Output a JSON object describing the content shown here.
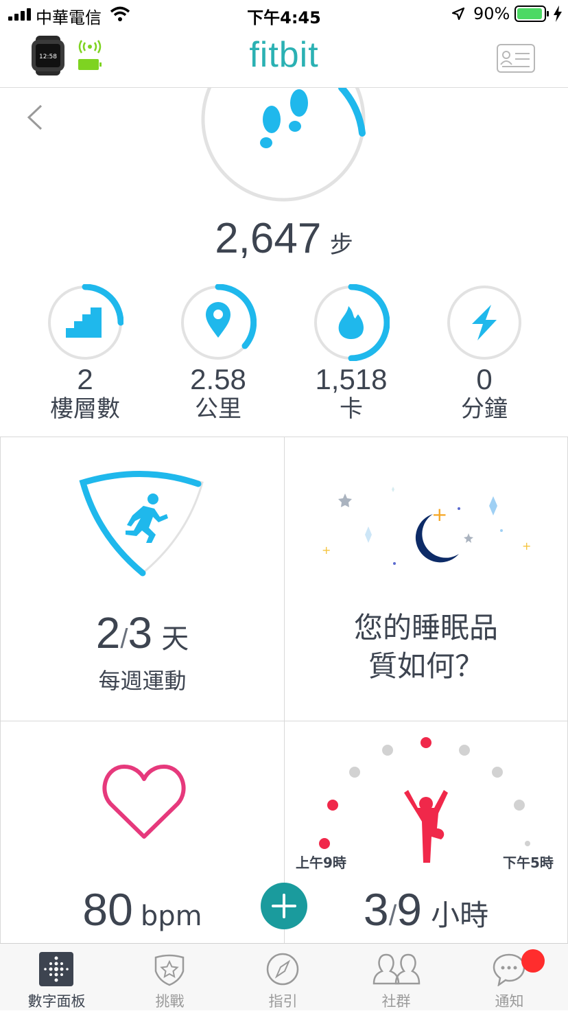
{
  "status_bar": {
    "carrier": "中華電信",
    "time": "下午4:45",
    "battery": "90%"
  },
  "header": {
    "logo": "fitbit"
  },
  "steps": {
    "value": "2,647",
    "unit": "步",
    "progress": 0.12
  },
  "stats": [
    {
      "value": "2",
      "unit": "樓層數",
      "icon": "stairs-icon",
      "progress": 0.25
    },
    {
      "value": "2.58",
      "unit": "公里",
      "icon": "location-pin-icon",
      "progress": 0.33
    },
    {
      "value": "1,518",
      "unit": "卡",
      "icon": "flame-icon",
      "progress": 0.5
    },
    {
      "value": "0",
      "unit": "分鐘",
      "icon": "lightning-icon",
      "progress": 0
    }
  ],
  "exercise": {
    "done": "2",
    "goal": "3",
    "unit": "天",
    "label": "每週運動"
  },
  "sleep": {
    "question_line1": "您的睡眠品",
    "question_line2": "質如何？"
  },
  "heart": {
    "value": "80",
    "unit": "bpm"
  },
  "hourly": {
    "done": "3",
    "goal": "9",
    "unit": "小時",
    "start_label": "上午9時",
    "end_label": "下午5時"
  },
  "tabs": [
    {
      "label": "數字面板",
      "icon": "dashboard-icon",
      "active": true
    },
    {
      "label": "挑戰",
      "icon": "challenge-star-icon",
      "active": false
    },
    {
      "label": "指引",
      "icon": "compass-icon",
      "active": false
    },
    {
      "label": "社群",
      "icon": "friends-icon",
      "active": false
    },
    {
      "label": "通知",
      "icon": "chat-bubble-icon",
      "active": false
    }
  ],
  "colors": {
    "brand": "#2bb1b3",
    "accent": "#1fb8ec",
    "heart": "#e6397c",
    "active_red": "#f0284a",
    "moon": "#0d2b67",
    "battery_green": "#4cd964"
  }
}
